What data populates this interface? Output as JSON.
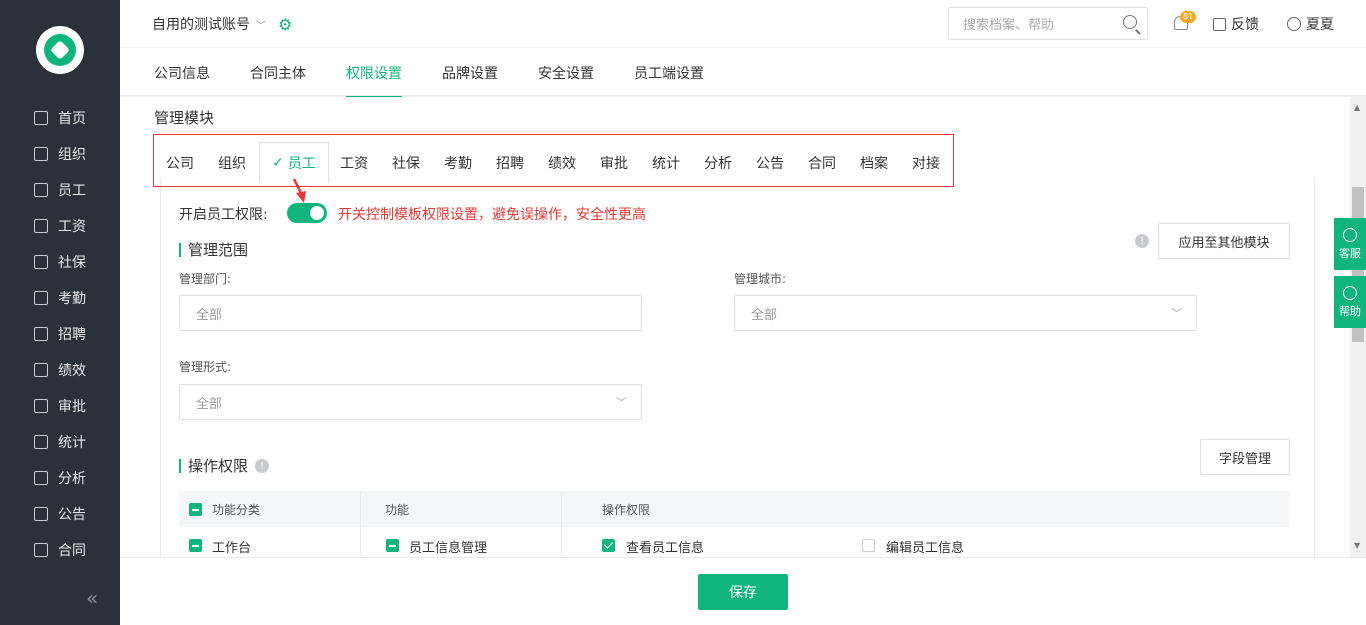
{
  "sidebar": {
    "items": [
      {
        "label": "首页",
        "icon": "home-icon"
      },
      {
        "label": "组织",
        "icon": "org-icon"
      },
      {
        "label": "员工",
        "icon": "employee-icon"
      },
      {
        "label": "工资",
        "icon": "salary-icon"
      },
      {
        "label": "社保",
        "icon": "shield-icon"
      },
      {
        "label": "考勤",
        "icon": "calendar-icon"
      },
      {
        "label": "招聘",
        "icon": "recruit-icon"
      },
      {
        "label": "绩效",
        "icon": "chart-icon"
      },
      {
        "label": "审批",
        "icon": "stamp-icon"
      },
      {
        "label": "统计",
        "icon": "bar-chart-icon"
      },
      {
        "label": "分析",
        "icon": "analysis-icon"
      },
      {
        "label": "公告",
        "icon": "notice-icon"
      },
      {
        "label": "合同",
        "icon": "contract-icon"
      }
    ],
    "collapse_glyph": "«"
  },
  "topbar": {
    "account": "自用的测试账号",
    "search_placeholder": "搜索档案、帮助",
    "badge": "81",
    "feedback": "反馈",
    "user": "夏夏"
  },
  "tabs": [
    "公司信息",
    "合同主体",
    "权限设置",
    "品牌设置",
    "安全设置",
    "员工端设置"
  ],
  "active_tab": "权限设置",
  "section_title": "管理模块",
  "modules": [
    "公司",
    "组织",
    "员工",
    "工资",
    "社保",
    "考勤",
    "招聘",
    "绩效",
    "审批",
    "统计",
    "分析",
    "公告",
    "合同",
    "档案",
    "对接"
  ],
  "active_module": "员工",
  "switch": {
    "label": "开启员工权限:",
    "on": true
  },
  "hint": "开关控制模板权限设置，避免误操作，安全性更高",
  "scope": {
    "title": "管理范围",
    "apply_button": "应用至其他模块",
    "dept_label": "管理部门:",
    "dept_value": "全部",
    "city_label": "管理城市:",
    "city_value": "全部",
    "form_label": "管理形式:",
    "form_value": "全部"
  },
  "ops": {
    "title": "操作权限",
    "field_button": "字段管理",
    "headers": [
      "功能分类",
      "功能",
      "操作权限"
    ],
    "row": {
      "category": "工作台",
      "function": "员工信息管理",
      "perm_view": "查看员工信息",
      "perm_edit": "编辑员工信息"
    }
  },
  "float": {
    "service": "客服",
    "help": "帮助"
  },
  "footer": {
    "save": "保存"
  },
  "colors": {
    "accent": "#10b57e",
    "sidebar": "#2b313b",
    "alert": "#e53935"
  }
}
